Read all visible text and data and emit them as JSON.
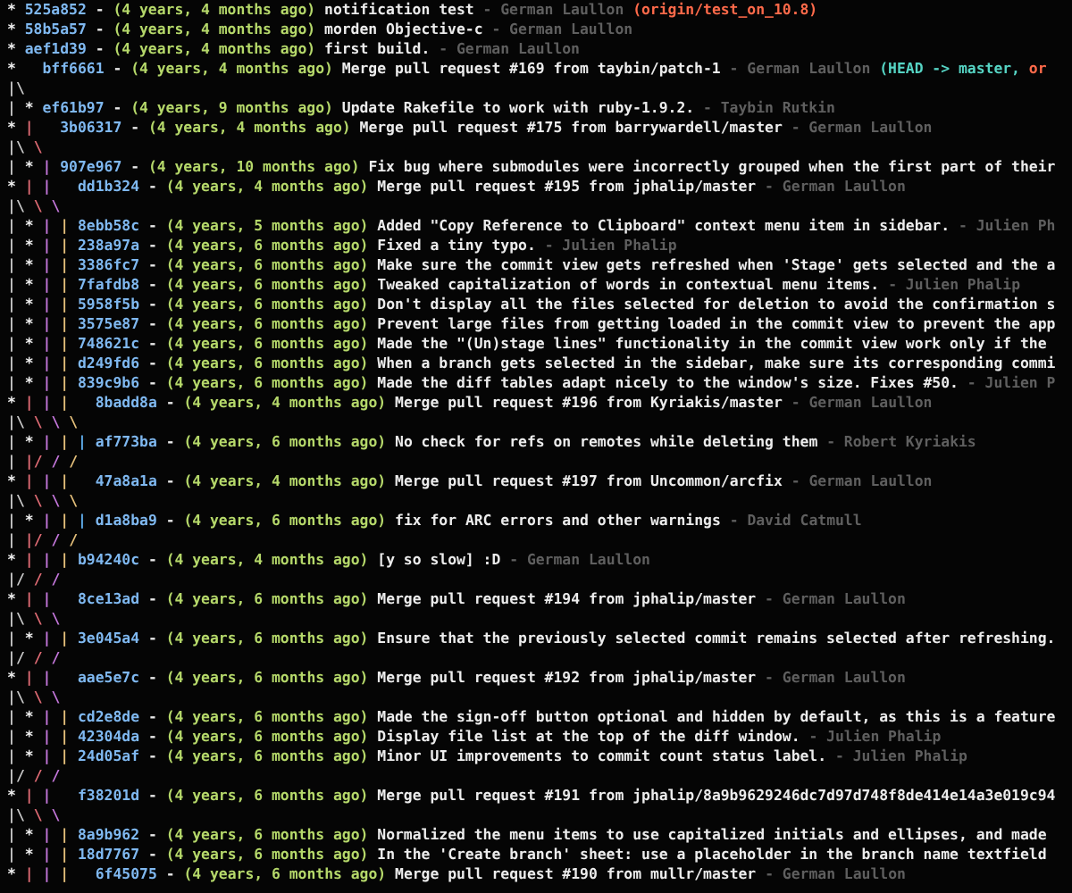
{
  "lines": [
    {
      "graph": "* ",
      "hash": "525a852",
      "dash": "-",
      "age": "(4 years, 4 months ago)",
      "message": "notification test",
      "author": "- German Laullon",
      "refs": [
        {
          "text": "(origin/test_on_10.8)",
          "kind": "remote"
        }
      ]
    },
    {
      "graph": "* ",
      "hash": "58b5a57",
      "dash": "-",
      "age": "(4 years, 4 months ago)",
      "message": "morden Objective-c",
      "author": "- German Laullon"
    },
    {
      "graph": "* ",
      "hash": "aef1d39",
      "dash": "-",
      "age": "(4 years, 4 months ago)",
      "message": "first build.",
      "author": "- German Laullon"
    },
    {
      "graph": "*   ",
      "hash": "bff6661",
      "dash": "-",
      "age": "(4 years, 4 months ago)",
      "message": "Merge pull request #169 from taybin/patch-1",
      "author": "- German Laullon",
      "refs": [
        {
          "text": "(HEAD -> master,",
          "kind": "head"
        },
        {
          "text": "or",
          "kind": "remote"
        }
      ]
    },
    {
      "graph": "|\\"
    },
    {
      "graph": "| * ",
      "hash": "ef61b97",
      "dash": "-",
      "age": "(4 years, 9 months ago)",
      "message": "Update Rakefile to work with ruby-1.9.2.",
      "author": "- Taybin Rutkin"
    },
    {
      "graph": "* |   ",
      "hash": "3b06317",
      "dash": "-",
      "age": "(4 years, 4 months ago)",
      "message": "Merge pull request #175 from barrywardell/master",
      "author": "- German Laullon"
    },
    {
      "graph": "|\\ \\"
    },
    {
      "graph": "| * | ",
      "hash": "907e967",
      "dash": "-",
      "age": "(4 years, 10 months ago)",
      "message": "Fix bug where submodules were incorrectly grouped when the first part of their"
    },
    {
      "graph": "* | |   ",
      "hash": "dd1b324",
      "dash": "-",
      "age": "(4 years, 4 months ago)",
      "message": "Merge pull request #195 from jphalip/master",
      "author": "- German Laullon"
    },
    {
      "graph": "|\\ \\ \\"
    },
    {
      "graph": "| * | | ",
      "hash": "8ebb58c",
      "dash": "-",
      "age": "(4 years, 5 months ago)",
      "message": "Added \"Copy Reference to Clipboard\" context menu item in sidebar.",
      "author": "- Julien Ph"
    },
    {
      "graph": "| * | | ",
      "hash": "238a97a",
      "dash": "-",
      "age": "(4 years, 6 months ago)",
      "message": "Fixed a tiny typo.",
      "author": "- Julien Phalip"
    },
    {
      "graph": "| * | | ",
      "hash": "3386fc7",
      "dash": "-",
      "age": "(4 years, 6 months ago)",
      "message": "Make sure the commit view gets refreshed when 'Stage' gets selected and the a"
    },
    {
      "graph": "| * | | ",
      "hash": "7fafdb8",
      "dash": "-",
      "age": "(4 years, 6 months ago)",
      "message": "Tweaked capitalization of words in contextual menu items.",
      "author": "- Julien Phalip"
    },
    {
      "graph": "| * | | ",
      "hash": "5958f5b",
      "dash": "-",
      "age": "(4 years, 6 months ago)",
      "message": "Don't display all the files selected for deletion to avoid the confirmation s"
    },
    {
      "graph": "| * | | ",
      "hash": "3575e87",
      "dash": "-",
      "age": "(4 years, 6 months ago)",
      "message": "Prevent large files from getting loaded in the commit view to prevent the app"
    },
    {
      "graph": "| * | | ",
      "hash": "748621c",
      "dash": "-",
      "age": "(4 years, 6 months ago)",
      "message": "Made the \"(Un)stage lines\" functionality in the commit view work only if the"
    },
    {
      "graph": "| * | | ",
      "hash": "d249fd6",
      "dash": "-",
      "age": "(4 years, 6 months ago)",
      "message": "When a branch gets selected in the sidebar, make sure its corresponding commi"
    },
    {
      "graph": "| * | | ",
      "hash": "839c9b6",
      "dash": "-",
      "age": "(4 years, 6 months ago)",
      "message": "Made the diff tables adapt nicely to the window's size. Fixes #50.",
      "author": "- Julien P"
    },
    {
      "graph": "* | | |   ",
      "hash": "8badd8a",
      "dash": "-",
      "age": "(4 years, 4 months ago)",
      "message": "Merge pull request #196 from Kyriakis/master",
      "author": "- German Laullon"
    },
    {
      "graph": "|\\ \\ \\ \\"
    },
    {
      "graph": "| * | | | ",
      "hash": "af773ba",
      "dash": "-",
      "age": "(4 years, 6 months ago)",
      "message": "No check for refs on remotes while deleting them",
      "author": "- Robert Kyriakis"
    },
    {
      "graph": "| |/ / /"
    },
    {
      "graph": "* | | |   ",
      "hash": "47a8a1a",
      "dash": "-",
      "age": "(4 years, 4 months ago)",
      "message": "Merge pull request #197 from Uncommon/arcfix",
      "author": "- German Laullon"
    },
    {
      "graph": "|\\ \\ \\ \\"
    },
    {
      "graph": "| * | | | ",
      "hash": "d1a8ba9",
      "dash": "-",
      "age": "(4 years, 6 months ago)",
      "message": "fix for ARC errors and other warnings",
      "author": "- David Catmull"
    },
    {
      "graph": "| |/ / /"
    },
    {
      "graph": "* | | | ",
      "hash": "b94240c",
      "dash": "-",
      "age": "(4 years, 4 months ago)",
      "message": "[y so slow] :D",
      "author": "- German Laullon"
    },
    {
      "graph": "|/ / /"
    },
    {
      "graph": "* | |   ",
      "hash": "8ce13ad",
      "dash": "-",
      "age": "(4 years, 6 months ago)",
      "message": "Merge pull request #194 from jphalip/master",
      "author": "- German Laullon"
    },
    {
      "graph": "|\\ \\ \\"
    },
    {
      "graph": "| * | | ",
      "hash": "3e045a4",
      "dash": "-",
      "age": "(4 years, 6 months ago)",
      "message": "Ensure that the previously selected commit remains selected after refreshing."
    },
    {
      "graph": "|/ / /"
    },
    {
      "graph": "* | |   ",
      "hash": "aae5e7c",
      "dash": "-",
      "age": "(4 years, 6 months ago)",
      "message": "Merge pull request #192 from jphalip/master",
      "author": "- German Laullon"
    },
    {
      "graph": "|\\ \\ \\"
    },
    {
      "graph": "| * | | ",
      "hash": "cd2e8de",
      "dash": "-",
      "age": "(4 years, 6 months ago)",
      "message": "Made the sign-off button optional and hidden by default, as this is a feature"
    },
    {
      "graph": "| * | | ",
      "hash": "42304da",
      "dash": "-",
      "age": "(4 years, 6 months ago)",
      "message": "Display file list at the top of the diff window.",
      "author": "- Julien Phalip"
    },
    {
      "graph": "| * | | ",
      "hash": "24d05af",
      "dash": "-",
      "age": "(4 years, 6 months ago)",
      "message": "Minor UI improvements to commit count status label.",
      "author": "- Julien Phalip"
    },
    {
      "graph": "|/ / /"
    },
    {
      "graph": "* | |   ",
      "hash": "f38201d",
      "dash": "-",
      "age": "(4 years, 6 months ago)",
      "message": "Merge pull request #191 from jphalip/8a9b9629246dc7d97d748f8de414e14a3e019c94"
    },
    {
      "graph": "|\\ \\ \\"
    },
    {
      "graph": "| * | | ",
      "hash": "8a9b962",
      "dash": "-",
      "age": "(4 years, 6 months ago)",
      "message": "Normalized the menu items to use capitalized initials and ellipses, and made"
    },
    {
      "graph": "| * | | ",
      "hash": "18d7767",
      "dash": "-",
      "age": "(4 years, 6 months ago)",
      "message": "In the 'Create branch' sheet: use a placeholder in the branch name textfield"
    },
    {
      "graph": "* | | |   ",
      "hash": "6f45075",
      "dash": "-",
      "age": "(4 years, 6 months ago)",
      "message": "Merge pull request #190 from mullr/master",
      "author": "- German Laullon"
    }
  ]
}
